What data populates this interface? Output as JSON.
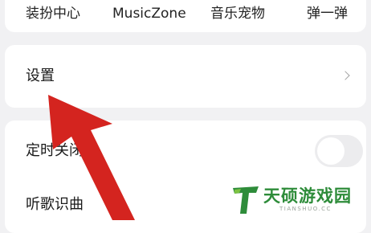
{
  "quick_entries": [
    {
      "label": "装扮中心"
    },
    {
      "label": "MusicZone"
    },
    {
      "label": "音乐宠物"
    },
    {
      "label": "弹一弹"
    }
  ],
  "settings": {
    "label": "设置",
    "icon": "chevron-right-icon"
  },
  "list": {
    "sleep_timer": {
      "label": "定时关闭",
      "toggle_on": false
    },
    "song_recognition": {
      "label": "听歌识曲"
    }
  },
  "overlay": {
    "arrow_color": "#d4241f"
  },
  "watermark": {
    "name": "天硕游戏园",
    "domain": "TIANSHUO.CC",
    "color": "#2e8c3a"
  }
}
